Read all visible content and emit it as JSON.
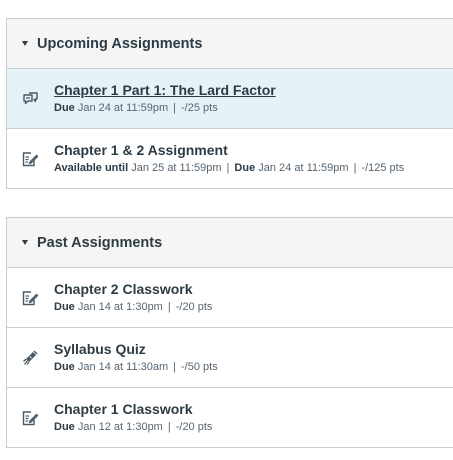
{
  "upcoming": {
    "title": "Upcoming Assignments",
    "items": [
      {
        "title": "Chapter 1 Part 1: The Lard Factor",
        "icon": "discussion-icon",
        "due_label": "Due",
        "due": "Jan 24 at 11:59pm",
        "pts": "-/25 pts"
      },
      {
        "title": "Chapter 1 & 2 Assignment",
        "icon": "assignment-icon",
        "avail_label": "Available until",
        "avail": "Jan 25 at 11:59pm",
        "due_label": "Due",
        "due": "Jan 24 at 11:59pm",
        "pts": "-/125 pts"
      }
    ]
  },
  "past": {
    "title": "Past Assignments",
    "items": [
      {
        "title": "Chapter 2 Classwork",
        "icon": "assignment-icon",
        "due_label": "Due",
        "due": "Jan 14 at 1:30pm",
        "pts": "-/20 pts"
      },
      {
        "title": "Syllabus Quiz",
        "icon": "quiz-icon",
        "due_label": "Due",
        "due": "Jan 14 at 11:30am",
        "pts": "-/50 pts"
      },
      {
        "title": "Chapter 1 Classwork",
        "icon": "assignment-icon",
        "due_label": "Due",
        "due": "Jan 12 at 1:30pm",
        "pts": "-/20 pts"
      }
    ]
  },
  "separator": "|"
}
